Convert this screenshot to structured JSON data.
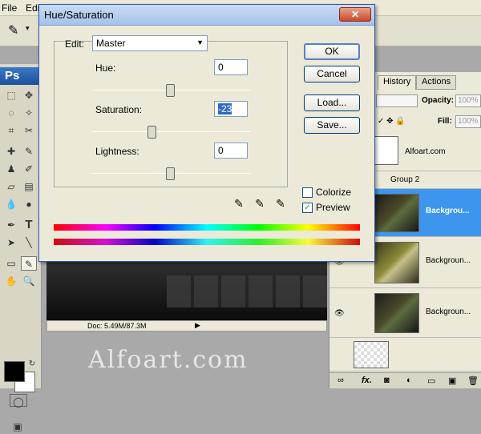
{
  "menu": {
    "file": "File",
    "edit": "Edi"
  },
  "toolbox": {
    "logo": "Ps"
  },
  "document": {
    "status": "Doc: 5.49M/87.3M"
  },
  "watermark": "Alfoart.com",
  "layers_panel": {
    "tabs": [
      "History",
      "Actions"
    ],
    "opacity_label": "Opacity:",
    "opacity_value": "100%",
    "fill_label": "Fill:",
    "fill_value": "100%",
    "rows": [
      {
        "name": "Alfoart.com",
        "visible": false
      },
      {
        "name": "Group 2",
        "visible": false
      },
      {
        "name": "Backgrou...",
        "visible": true,
        "selected": true
      },
      {
        "name": "Backgroun...",
        "visible": true
      },
      {
        "name": "Backgroun...",
        "visible": true
      }
    ]
  },
  "dialog": {
    "title": "Hue/Saturation",
    "close_glyph": "✕",
    "edit_label": "Edit:",
    "edit_value": "Master",
    "hue_label": "Hue:",
    "hue_value": "0",
    "saturation_label": "Saturation:",
    "saturation_value": "-23",
    "lightness_label": "Lightness:",
    "lightness_value": "0",
    "ok_label": "OK",
    "cancel_label": "Cancel",
    "load_label": "Load...",
    "save_label": "Save...",
    "colorize_label": "Colorize",
    "colorize_checked": false,
    "preview_label": "Preview",
    "preview_checked": true,
    "check_glyph": "✓"
  },
  "colors": {
    "title_gradient_top": "#c9dcf5",
    "selection_blue": "#3d95ee",
    "field_highlight": "#316ac5"
  }
}
